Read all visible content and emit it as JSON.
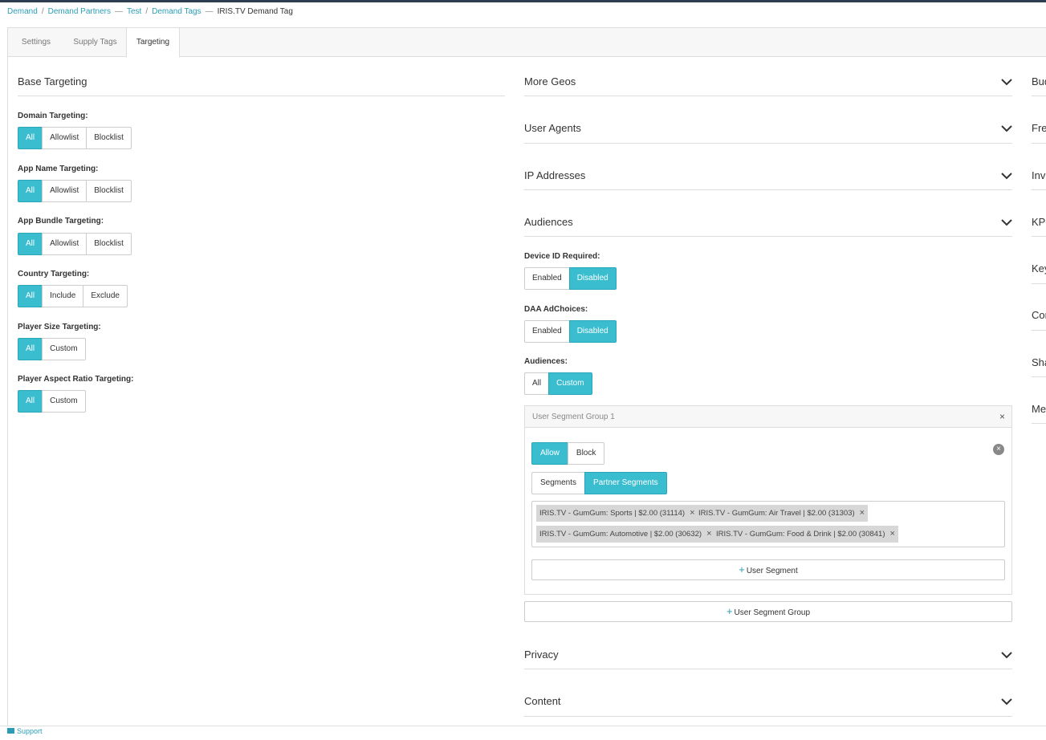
{
  "breadcrumb": {
    "items": [
      "Demand",
      "Demand Partners",
      "Test",
      "Demand Tags"
    ],
    "current": "IRIS.TV Demand Tag",
    "sep": "/",
    "dash": "—"
  },
  "tabs": [
    "Settings",
    "Supply Tags",
    "Targeting"
  ],
  "base": {
    "title": "Base Targeting",
    "fields": [
      {
        "label": "Domain Targeting:",
        "options": [
          "All",
          "Allowlist",
          "Blocklist"
        ]
      },
      {
        "label": "App Name Targeting:",
        "options": [
          "All",
          "Allowlist",
          "Blocklist"
        ]
      },
      {
        "label": "App Bundle Targeting:",
        "options": [
          "All",
          "Allowlist",
          "Blocklist"
        ]
      },
      {
        "label": "Country Targeting:",
        "options": [
          "All",
          "Include",
          "Exclude"
        ]
      },
      {
        "label": "Player Size Targeting:",
        "options": [
          "All",
          "Custom"
        ]
      },
      {
        "label": "Player Aspect Ratio Targeting:",
        "options": [
          "All",
          "Custom"
        ]
      }
    ]
  },
  "middle": {
    "sections": [
      "More Geos",
      "User Agents",
      "IP Addresses",
      "Audiences"
    ],
    "device_id": {
      "label": "Device ID Required:",
      "options": [
        "Enabled",
        "Disabled"
      ]
    },
    "daa": {
      "label": "DAA AdChoices:",
      "options": [
        "Enabled",
        "Disabled"
      ]
    },
    "audiences": {
      "label": "Audiences:",
      "options": [
        "All",
        "Custom"
      ]
    },
    "segment_group": {
      "title": "User Segment Group 1",
      "close": "×",
      "mode": [
        "Allow",
        "Block"
      ],
      "kind": [
        "Segments",
        "Partner Segments"
      ],
      "remove": "×",
      "tags": [
        "IRIS.TV - GumGum: Sports | $2.00 (31114)",
        "IRIS.TV - GumGum: Air Travel | $2.00 (31303)",
        "IRIS.TV - GumGum: Automotive | $2.00 (30632)",
        "IRIS.TV - GumGum: Food & Drink | $2.00 (30841)"
      ],
      "add_segment": "User Segment"
    },
    "add_group": "User Segment Group",
    "lower_sections": [
      "Privacy",
      "Content"
    ]
  },
  "right_sections": [
    "Bud",
    "Fre",
    "Inv",
    "KPI",
    "Key",
    "Cor",
    "Sha",
    "Me"
  ],
  "footer": {
    "support": "Support"
  },
  "colors": {
    "accent": "#3bbdd0",
    "link": "#2a9db5"
  }
}
